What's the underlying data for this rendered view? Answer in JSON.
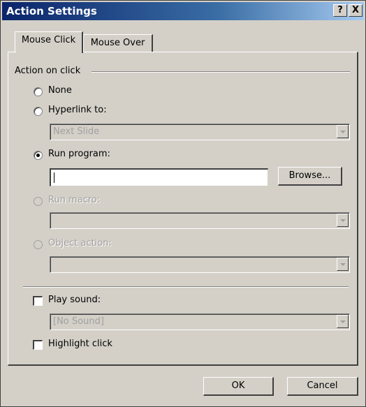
{
  "window": {
    "title": "Action Settings",
    "help_button": "?",
    "close_button": "X"
  },
  "tabs": [
    {
      "label": "Mouse Click",
      "active": true
    },
    {
      "label": "Mouse Over",
      "active": false
    }
  ],
  "group": {
    "label": "Action on click"
  },
  "options": {
    "none": {
      "label": "None",
      "selected": false,
      "enabled": true
    },
    "hyperlink": {
      "label": "Hyperlink to:",
      "selected": false,
      "enabled": true,
      "value": "Next Slide"
    },
    "run_program": {
      "label": "Run program:",
      "selected": true,
      "enabled": true,
      "value": "",
      "browse_label": "Browse..."
    },
    "run_macro": {
      "label": "Run macro:",
      "selected": false,
      "enabled": false,
      "value": ""
    },
    "object_action": {
      "label": "Object action:",
      "selected": false,
      "enabled": false,
      "value": ""
    }
  },
  "play_sound": {
    "label": "Play sound:",
    "checked": false,
    "value": "[No Sound]"
  },
  "highlight_click": {
    "label": "Highlight click",
    "checked": false
  },
  "footer": {
    "ok_label": "OK",
    "cancel_label": "Cancel"
  }
}
